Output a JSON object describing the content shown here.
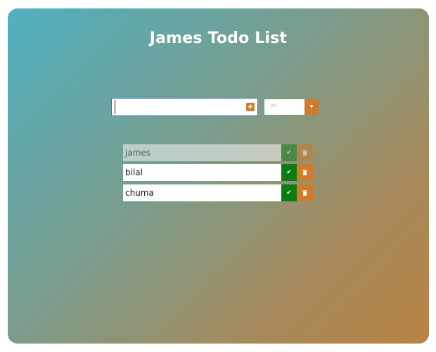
{
  "app": {
    "title": "James Todo List"
  },
  "form": {
    "input_value": "",
    "add_icon": "plus-icon",
    "filter_selected": "All",
    "filter_arrow_icon": "caret-down-icon"
  },
  "todos": [
    {
      "text": "james",
      "completed": true
    },
    {
      "text": "bilal",
      "completed": false
    },
    {
      "text": "chuma",
      "completed": false
    }
  ],
  "colors": {
    "accent": "#d07a2c",
    "check": "#0b7d12",
    "input_border": "#3a6fd8"
  },
  "icons": {
    "check": "check-icon",
    "trash": "trash-icon"
  }
}
